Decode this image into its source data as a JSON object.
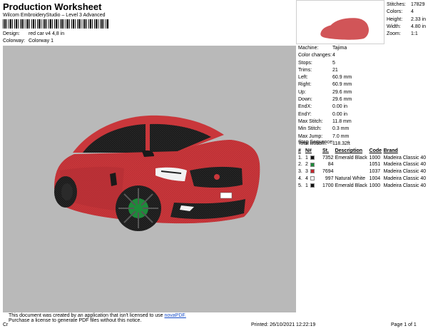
{
  "header": {
    "title": "Production Worksheet",
    "software": "Wilcom EmbroideryStudio – Level 3 Advanced"
  },
  "design_info": [
    {
      "label": "Design:",
      "value": "red car v4 4,8 in"
    },
    {
      "label": "Colorway:",
      "value": "Colorway 1"
    }
  ],
  "stats": [
    {
      "label": "Stitches:",
      "value": "17829"
    },
    {
      "label": "Colors:",
      "value": "4"
    },
    {
      "label": "Height:",
      "value": "2.33 in"
    },
    {
      "label": "Width:",
      "value": "4.80 in"
    },
    {
      "label": "Zoom:",
      "value": "1:1"
    }
  ],
  "params": [
    {
      "label": "Machine:",
      "value": "Tajima"
    },
    {
      "label": "Color changes:",
      "value": "4"
    },
    {
      "label": "Stops:",
      "value": "5"
    },
    {
      "label": "Trims:",
      "value": "21"
    },
    {
      "label": "Left:",
      "value": "60.9 mm"
    },
    {
      "label": "Right:",
      "value": "60.9 mm"
    },
    {
      "label": "Up:",
      "value": "29.6 mm"
    },
    {
      "label": "Down:",
      "value": "29.6 mm"
    },
    {
      "label": "EndX:",
      "value": "0.00 in"
    },
    {
      "label": "EndY:",
      "value": "0.00 in"
    },
    {
      "label": "Max Stitch:",
      "value": "11.8 mm"
    },
    {
      "label": "Min Stitch:",
      "value": "0.3 mm"
    },
    {
      "label": "Max Jump:",
      "value": "7.0 mm"
    },
    {
      "label": "Total Bobbin:",
      "value": "118.32ft"
    }
  ],
  "stop_sequence": {
    "title": "Stop Sequence:",
    "headers": [
      "#",
      "N#",
      "St.",
      "Description",
      "Code",
      "Brand"
    ],
    "rows": [
      {
        "num": "1.",
        "n": "1",
        "swatch": "#111111",
        "st": "7352",
        "desc": "Emerald Black",
        "code": "1000",
        "brand": "Madeira Classic 40"
      },
      {
        "num": "2.",
        "n": "2",
        "swatch": "#1e8a3a",
        "st": "84",
        "desc": "",
        "code": "1051",
        "brand": "Madeira Classic 40"
      },
      {
        "num": "3.",
        "n": "3",
        "swatch": "#c3272d",
        "st": "7694",
        "desc": "",
        "code": "1037",
        "brand": "Madeira Classic 40"
      },
      {
        "num": "4.",
        "n": "4",
        "swatch": "#f4f4f4",
        "st": "997",
        "desc": "Natural White",
        "code": "1004",
        "brand": "Madeira Classic 40"
      },
      {
        "num": "5.",
        "n": "1",
        "swatch": "#111111",
        "st": "1700",
        "desc": "Emerald Black",
        "code": "1000",
        "brand": "Madeira Classic 40"
      }
    ]
  },
  "notice": {
    "line1": "This document was created by an application that isn't licensed to use",
    "link": "novaPDF.",
    "line2": "Purchase a license to generate PDF files without this notice."
  },
  "footer": {
    "left": "Cr",
    "printed": "Printed: 26/10/2021 12:22:19",
    "page": "Page 1 of 1"
  },
  "colors": {
    "car_body": "#c9373b",
    "rim": "#1e8a3a",
    "background": "#b9b9b9"
  }
}
